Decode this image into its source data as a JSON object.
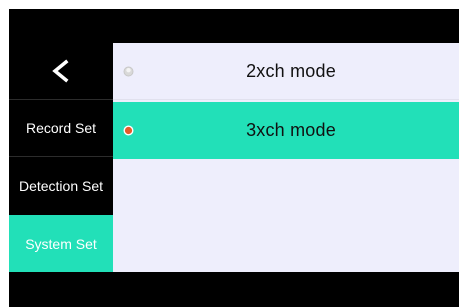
{
  "sidebar": {
    "back_icon": "chevron-left-icon",
    "items": [
      {
        "label": "Record Set",
        "selected": false
      },
      {
        "label": "Detection Set",
        "selected": false
      },
      {
        "label": "System Set",
        "selected": true
      }
    ]
  },
  "options": [
    {
      "label": "2xch mode",
      "selected": false,
      "radio_icon": "radio-unselected-icon"
    },
    {
      "label": "3xch mode",
      "selected": true,
      "radio_icon": "radio-selected-icon"
    }
  ],
  "colors": {
    "screen_background": "#000000",
    "content_background": "#eeeefc",
    "accent": "#22e0b8",
    "radio_selected": "#e65a2a",
    "radio_unselected": "#d9d9d9"
  }
}
